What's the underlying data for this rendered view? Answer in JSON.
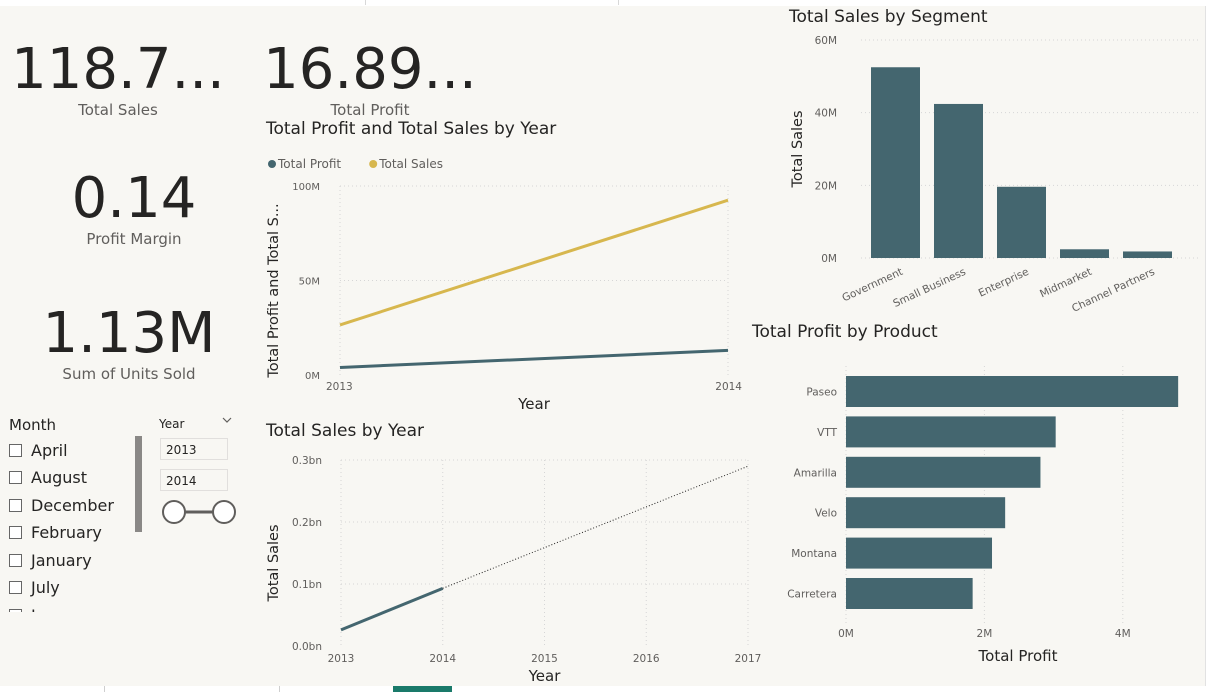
{
  "cards": [
    {
      "value": "118.7...",
      "label": "Total Sales"
    },
    {
      "value": "16.89...",
      "label": "Total Profit"
    },
    {
      "value": "0.14",
      "label": "Profit Margin"
    },
    {
      "value": "1.13M",
      "label": "Sum of Units Sold"
    }
  ],
  "month_slicer": {
    "title": "Month",
    "items": [
      "April",
      "August",
      "December",
      "February",
      "January",
      "July",
      "June"
    ]
  },
  "year_slicer": {
    "title": "Year",
    "start": "2013",
    "end": "2014"
  },
  "colors": {
    "teal": "#44666f",
    "gold": "#d7b74e"
  },
  "icons": [
    "chevron-down-icon"
  ],
  "chart_data": [
    {
      "type": "line",
      "title": "Total Profit and Total Sales by Year",
      "xlabel": "Year",
      "ylabel": "Total Profit and Total S...",
      "x": [
        "2013",
        "2014"
      ],
      "ylim": [
        0,
        100000000
      ],
      "yticks": [
        "0M",
        "50M",
        "100M"
      ],
      "legend": "top-left",
      "series": [
        {
          "name": "Total Profit",
          "values": [
            4000000,
            13000000
          ],
          "color": "#44666f"
        },
        {
          "name": "Total Sales",
          "values": [
            26500000,
            92500000
          ],
          "color": "#d7b74e"
        }
      ]
    },
    {
      "type": "line",
      "title": "Total Sales by Year",
      "xlabel": "Year",
      "ylabel": "Total Sales",
      "x": [
        "2013",
        "2014",
        "2015",
        "2016",
        "2017"
      ],
      "xlim": [
        2013,
        2017
      ],
      "ylim": [
        0,
        0.3
      ],
      "yticks": [
        "0.0bn",
        "0.1bn",
        "0.2bn",
        "0.3bn"
      ],
      "series": [
        {
          "values": [
            0.026,
            0.093
          ],
          "color": "#44666f"
        }
      ],
      "trend": {
        "x": [
          2014,
          2017
        ],
        "values": [
          0.093,
          0.29
        ]
      }
    },
    {
      "type": "bar",
      "title": "Total Sales by Segment",
      "ylabel": "Total Sales",
      "categories": [
        "Government",
        "Small Business",
        "Enterprise",
        "Midmarket",
        "Channel Partners"
      ],
      "values": [
        52500000,
        42400000,
        19600000,
        2400000,
        1800000
      ],
      "ylim": [
        0,
        60000000
      ],
      "yticks": [
        "0M",
        "20M",
        "40M",
        "60M"
      ],
      "color": "#44666f"
    },
    {
      "type": "bar",
      "orientation": "horizontal",
      "title": "Total Profit by Product",
      "xlabel": "Total Profit",
      "categories": [
        "Paseo",
        "VTT",
        "Amarilla",
        "Velo",
        "Montana",
        "Carretera"
      ],
      "values": [
        4800000,
        3030000,
        2810000,
        2300000,
        2110000,
        1830000
      ],
      "xlim": [
        0,
        5000000
      ],
      "xticks": [
        "0M",
        "2M",
        "4M"
      ],
      "color": "#44666f"
    }
  ]
}
